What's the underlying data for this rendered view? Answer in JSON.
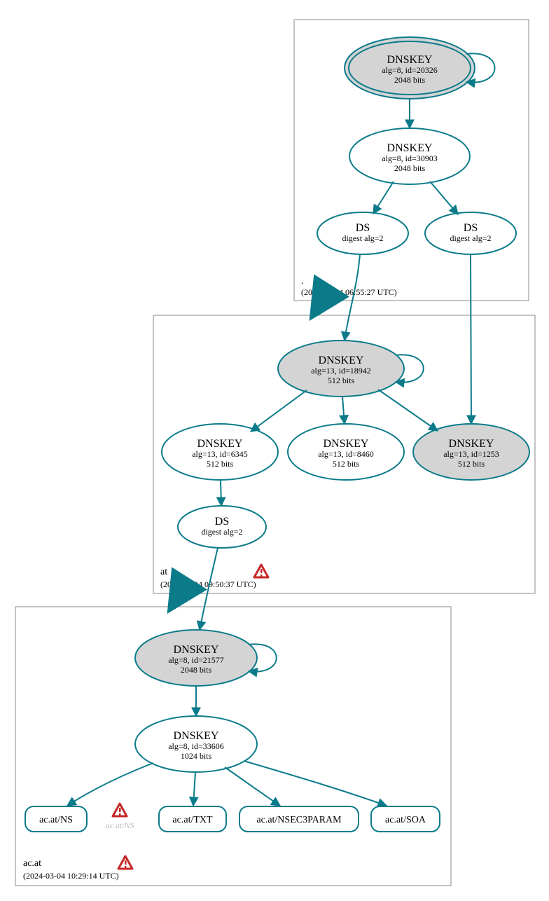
{
  "colors": {
    "teal": "#0b7b8a",
    "grayFill": "#d4d4d4",
    "warnFill": "#c62828",
    "warnStroke": "#c62828",
    "boxStroke": "#888888",
    "ghost": "#bbbbbb"
  },
  "zones": {
    "root": {
      "label": ".",
      "timestamp": "(2024-03-04 06:55:27 UTC)"
    },
    "at": {
      "label": "at",
      "timestamp": "(2024-03-04 09:50:37 UTC)"
    },
    "acat": {
      "label": "ac.at",
      "timestamp": "(2024-03-04 10:29:14 UTC)"
    }
  },
  "nodes": {
    "rootKsk": {
      "title": "DNSKEY",
      "line2": "alg=8, id=20326",
      "line3": "2048 bits"
    },
    "rootZsk": {
      "title": "DNSKEY",
      "line2": "alg=8, id=30903",
      "line3": "2048 bits"
    },
    "ds1": {
      "title": "DS",
      "line2": "digest alg=2"
    },
    "ds2": {
      "title": "DS",
      "line2": "digest alg=2"
    },
    "atKsk": {
      "title": "DNSKEY",
      "line2": "alg=13, id=18942",
      "line3": "512 bits"
    },
    "atZsk1": {
      "title": "DNSKEY",
      "line2": "alg=13, id=6345",
      "line3": "512 bits"
    },
    "atZsk2": {
      "title": "DNSKEY",
      "line2": "alg=13, id=8460",
      "line3": "512 bits"
    },
    "atZsk3": {
      "title": "DNSKEY",
      "line2": "alg=13, id=1253",
      "line3": "512 bits"
    },
    "atDs": {
      "title": "DS",
      "line2": "digest alg=2"
    },
    "acatKsk": {
      "title": "DNSKEY",
      "line2": "alg=8, id=21577",
      "line3": "2048 bits"
    },
    "acatZsk": {
      "title": "DNSKEY",
      "line2": "alg=8, id=33606",
      "line3": "1024 bits"
    },
    "recNs": {
      "title": "ac.at/NS"
    },
    "recNsGhost": {
      "title": "ac.at/NS"
    },
    "recTxt": {
      "title": "ac.at/TXT"
    },
    "recNsec": {
      "title": "ac.at/NSEC3PARAM"
    },
    "recSoa": {
      "title": "ac.at/SOA"
    }
  }
}
